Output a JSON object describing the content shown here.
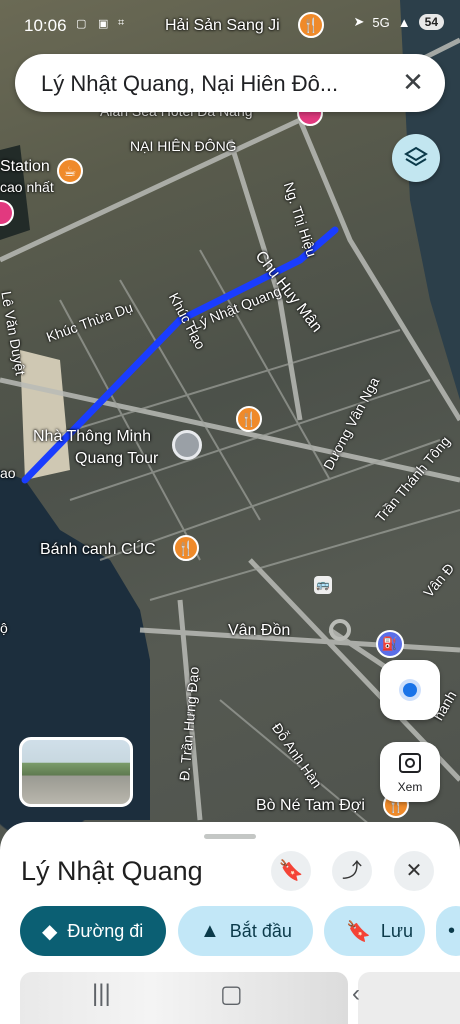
{
  "status": {
    "time": "10:06",
    "battery": "54",
    "net": "5G"
  },
  "search": {
    "query": "Lý Nhật Quang, Nại Hiên Đô..."
  },
  "map": {
    "top_poi": "Hải Sản Sang Ji",
    "labels": {
      "nai_hien_dong": "NẠI HIÊN ĐÔNG",
      "hotel": "Alan Sea Hotel Đà Nẵng",
      "station": "Station",
      "cao_nhat": "cao nhất",
      "ng_thi_hieu": "Ng. Thị Hiệu",
      "chu_huy_man": "Chu Huy Mân",
      "ly_nhat_quang": "Lý Nhật Quang",
      "khuc_thua_du": "Khúc Thừa Dụ",
      "khuc_hao": "Khúc Hạo",
      "le_van_duyet": "Lê Văn Duyệt",
      "nha_thong_minh_1": "Nhà Thông Minh",
      "nha_thong_minh_2": "Quang Tour",
      "duong_van_nga": "Dương Vân Nga",
      "tran_thanh_tong": "Trần Thánh Tông",
      "banh_canh": "Bánh canh CÚC",
      "van_don": "Vân Đồn",
      "van_don_right": "Vân Đ",
      "tran_hung_dao": "Đ. Trần Hưng Đạo",
      "do_anh_han": "Đỗ Anh Hàn",
      "bo_ne": "Bò Né Tam Đợi",
      "hanh": "hánh",
      "ao": "ao",
      "o_left": "ộ"
    }
  },
  "controls": {
    "xem_label": "Xem"
  },
  "sheet": {
    "title": "Lý Nhật Quang",
    "directions": "Đường đi",
    "start": "Bắt đầu",
    "save": "Lưu"
  },
  "colors": {
    "route": "#1a3dff",
    "primary_chip": "#0b5f73",
    "chip": "#c2e7f7",
    "poi_orange": "#ef8a2a"
  }
}
